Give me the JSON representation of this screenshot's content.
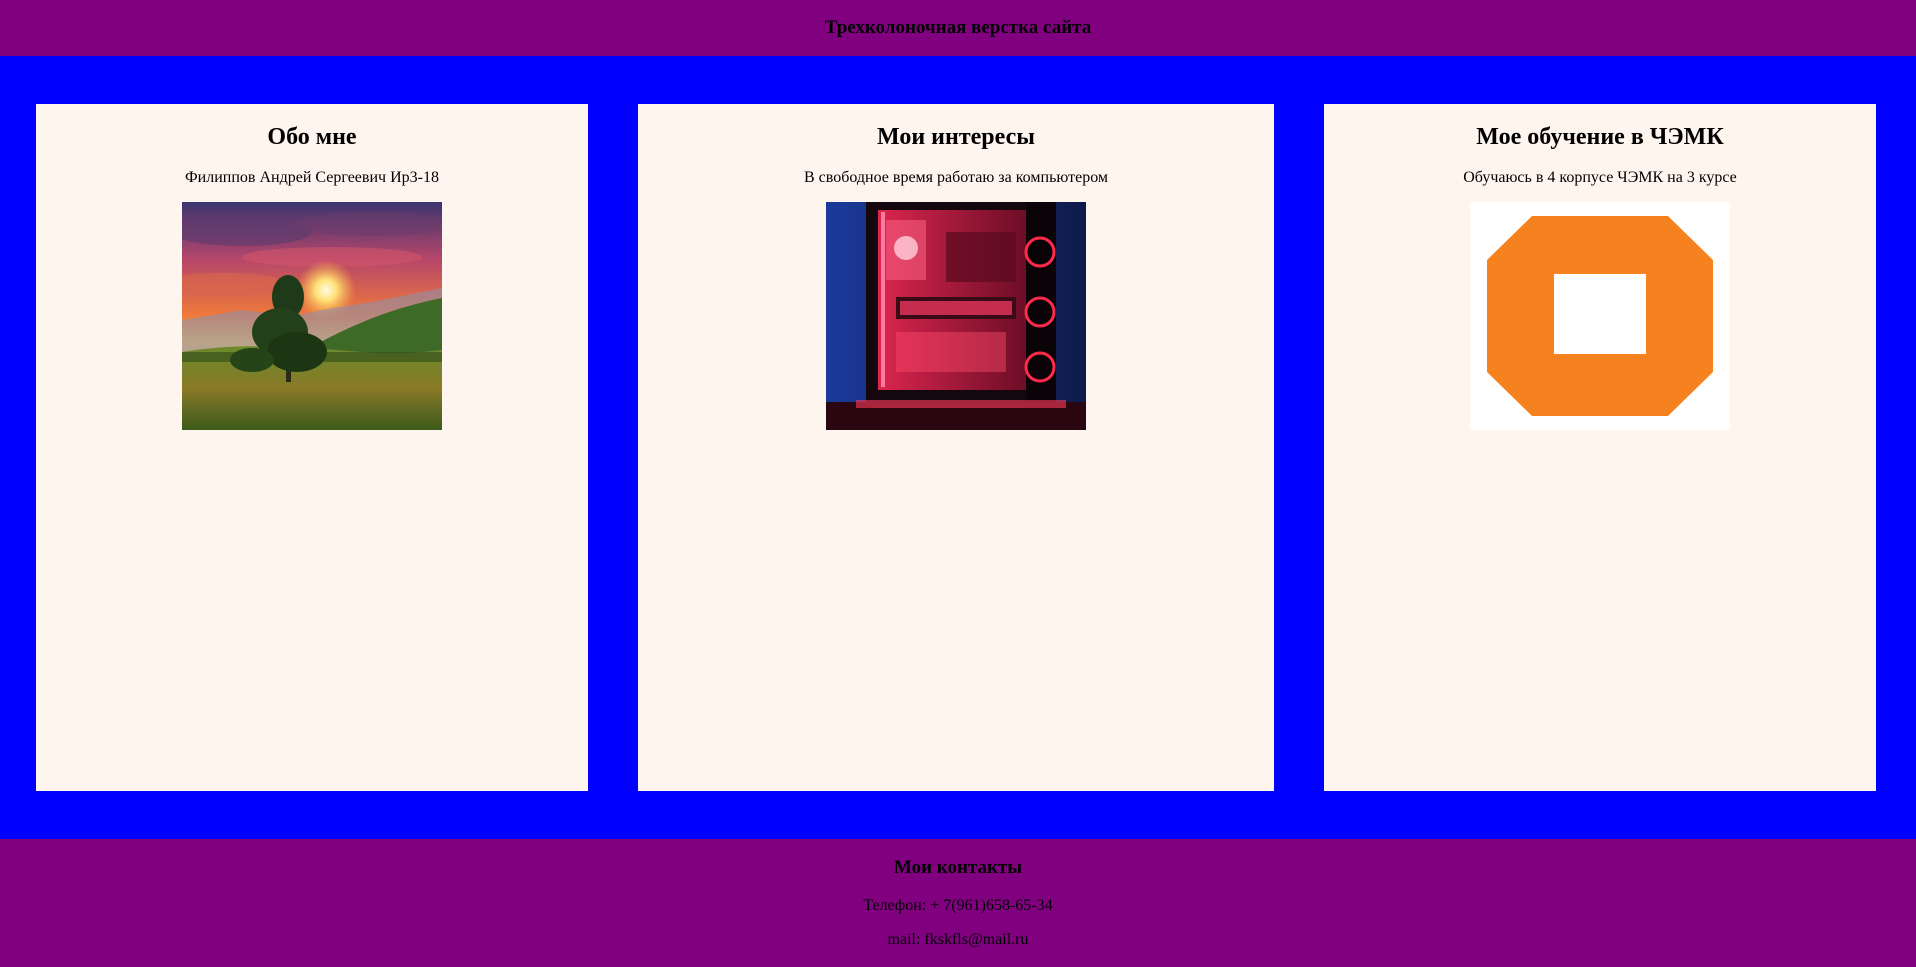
{
  "header": {
    "title": "Трехколоночная верстка сайта"
  },
  "columns": [
    {
      "heading": "Обо мне",
      "text": "Филиппов Андрей Сергеевич Ир3-18",
      "image": "sunset-landscape-photo"
    },
    {
      "heading": "Мои интересы",
      "text": "В свободное время работаю за компьютером",
      "image": "red-lit-pc-case-photo"
    },
    {
      "heading": "Мое обучение в ЧЭМК",
      "text": "Обучаюсь в 4 корпусе ЧЭМК на 3 курсе",
      "image": "orange-octagon-logo"
    }
  ],
  "footer": {
    "title": "Мои контакты",
    "phone": "Телефон: + 7(961)658-65-34",
    "mail": "mail: fkskfls@mail.ru"
  },
  "colors": {
    "header_bg": "#800080",
    "main_bg": "#0000ff",
    "column_bg": "#fff5ef",
    "logo_orange": "#f5821f"
  }
}
